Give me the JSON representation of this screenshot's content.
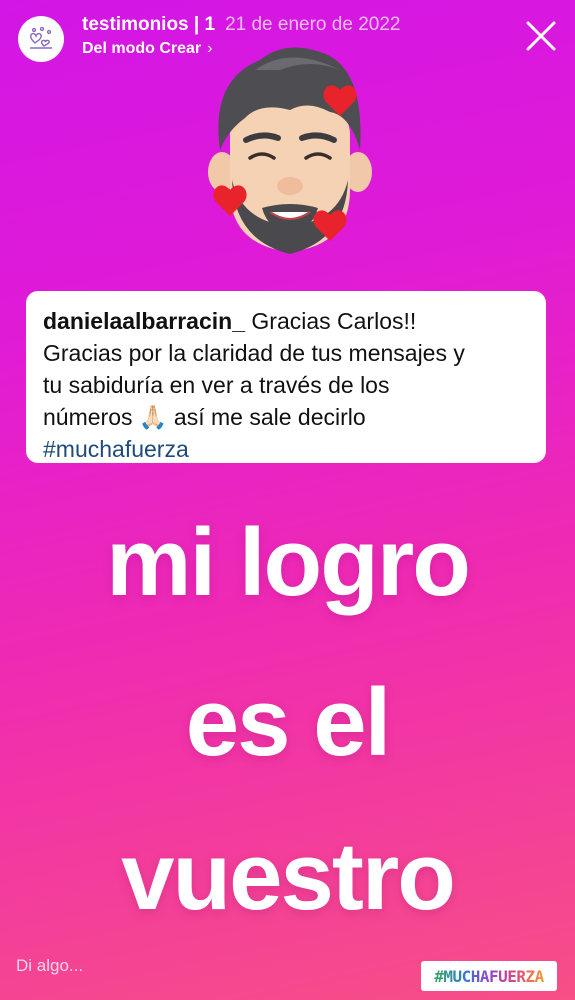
{
  "header": {
    "account": "testimonios | 1",
    "date": "21 de enero de 2022",
    "subtitle": "Del modo Crear",
    "subtitle_chevron": "›",
    "avatar_icon": "heart-hands-icon",
    "close_icon": "close-icon"
  },
  "comment": {
    "username": "danielaalbarracin_",
    "line1": " Gracias Carlos!!",
    "line2": "Gracias por la claridad de tus mensajes y",
    "line3": "tu sabiduría en ver a través de los",
    "line4_before": "números ",
    "emoji": "🙏🏻",
    "line4_after": " así me sale decirlo",
    "hashtag": "#muchafuerza"
  },
  "main_text": {
    "line1": "mi logro",
    "line2": "es el",
    "line3": "vuestro"
  },
  "footer": {
    "reply_placeholder": "Di algo...",
    "hashtag_sticker": "#MUCHAFUERZA"
  },
  "colors": {
    "gradient_top": "#d316e6",
    "gradient_bottom": "#f74f86",
    "hashtag_blue": "#1e4b7a"
  }
}
